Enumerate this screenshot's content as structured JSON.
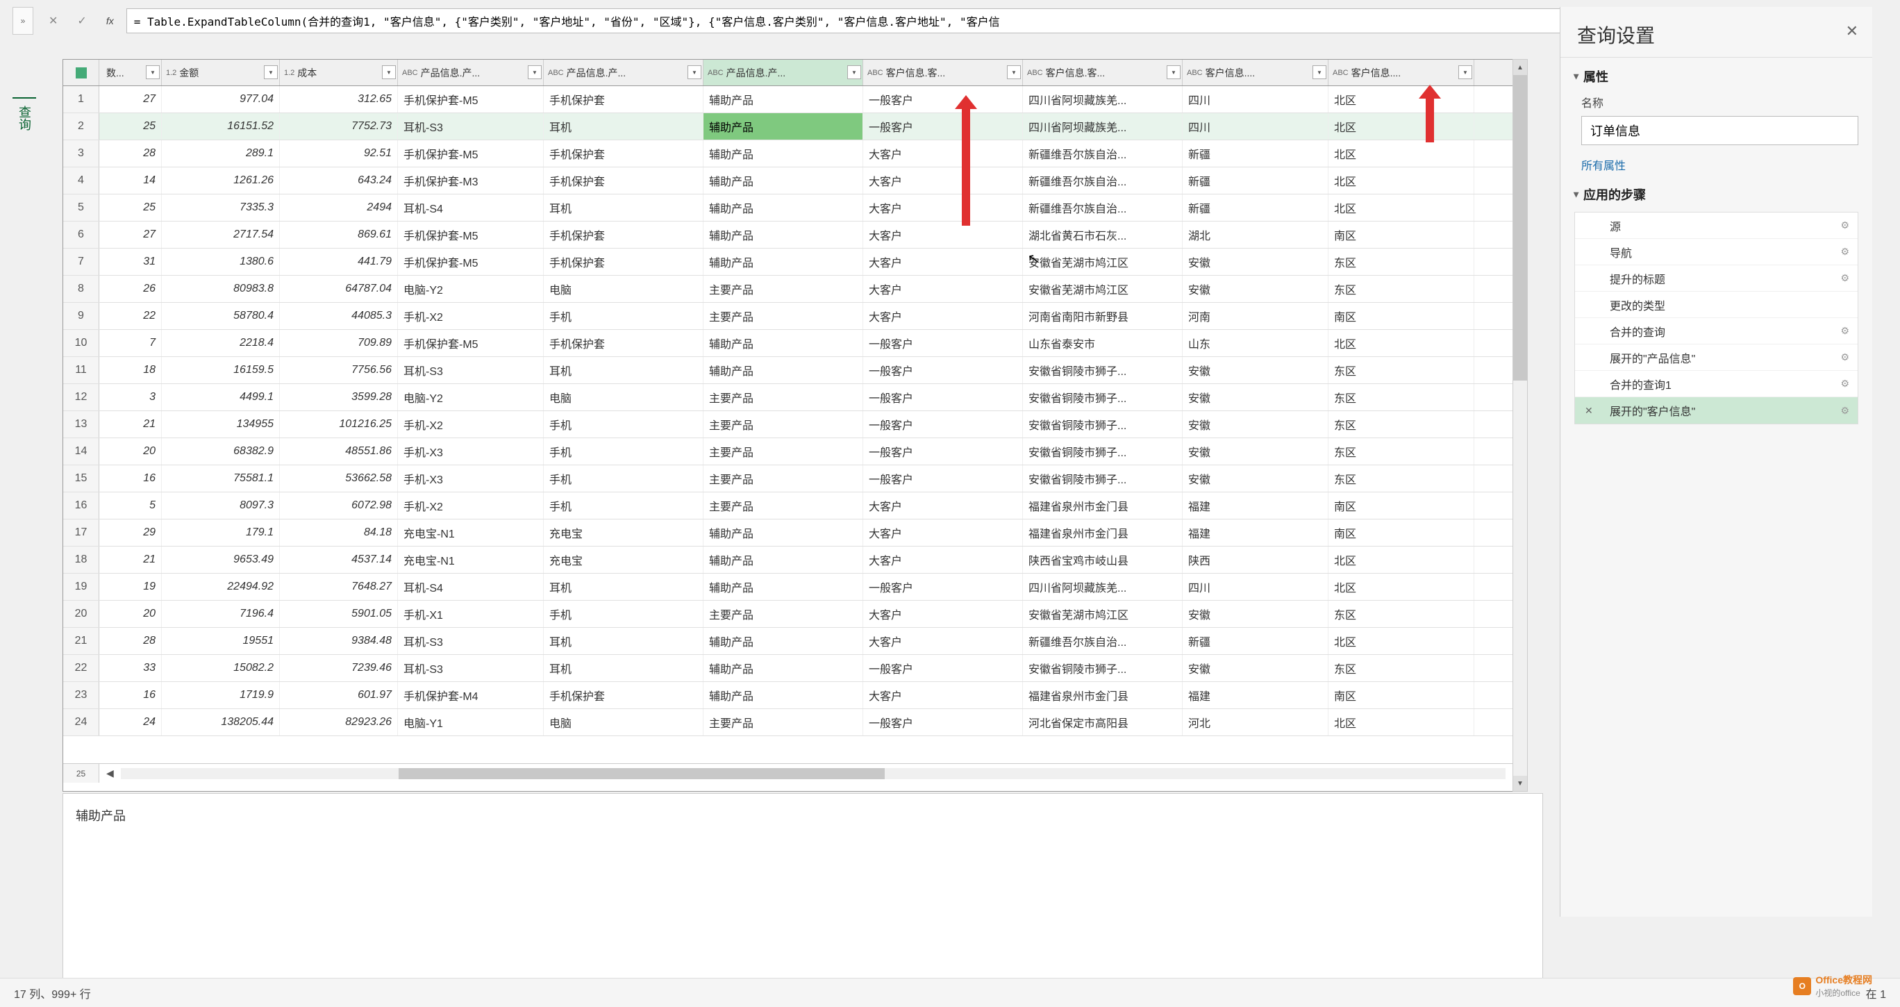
{
  "left_tab_label": "查询",
  "formula_bar": {
    "value": "= Table.ExpandTableColumn(合并的查询1, \"客户信息\", {\"客户类别\", \"客户地址\", \"省份\", \"区域\"}, {\"客户信息.客户类别\", \"客户信息.客户地址\", \"客户信"
  },
  "columns": [
    {
      "type": "",
      "label": "数...",
      "w": "c0"
    },
    {
      "type": "1.2",
      "label": "金额",
      "w": "c1"
    },
    {
      "type": "1.2",
      "label": "成本",
      "w": "c2"
    },
    {
      "type": "ABC",
      "label": "产品信息.产...",
      "w": "c3"
    },
    {
      "type": "ABC",
      "label": "产品信息.产...",
      "w": "c4"
    },
    {
      "type": "ABC",
      "label": "产品信息.产...",
      "w": "c5",
      "active": true
    },
    {
      "type": "ABC",
      "label": "客户信息.客...",
      "w": "c6"
    },
    {
      "type": "ABC",
      "label": "客户信息.客...",
      "w": "c7"
    },
    {
      "type": "ABC",
      "label": "客户信息....",
      "w": "c8"
    },
    {
      "type": "ABC",
      "label": "客户信息....",
      "w": "c9"
    }
  ],
  "rows": [
    {
      "n": 1,
      "d": [
        "27",
        "977.04",
        "312.65",
        "手机保护套-M5",
        "手机保护套",
        "辅助产品",
        "一般客户",
        "四川省阿坝藏族羌...",
        "四川",
        "北区"
      ]
    },
    {
      "n": 2,
      "d": [
        "25",
        "16151.52",
        "7752.73",
        "耳机-S3",
        "耳机",
        "辅助产品",
        "一般客户",
        "四川省阿坝藏族羌...",
        "四川",
        "北区"
      ],
      "sel": true,
      "selcol": 5
    },
    {
      "n": 3,
      "d": [
        "28",
        "289.1",
        "92.51",
        "手机保护套-M5",
        "手机保护套",
        "辅助产品",
        "大客户",
        "新疆维吾尔族自治...",
        "新疆",
        "北区"
      ]
    },
    {
      "n": 4,
      "d": [
        "14",
        "1261.26",
        "643.24",
        "手机保护套-M3",
        "手机保护套",
        "辅助产品",
        "大客户",
        "新疆维吾尔族自治...",
        "新疆",
        "北区"
      ]
    },
    {
      "n": 5,
      "d": [
        "25",
        "7335.3",
        "2494",
        "耳机-S4",
        "耳机",
        "辅助产品",
        "大客户",
        "新疆维吾尔族自治...",
        "新疆",
        "北区"
      ]
    },
    {
      "n": 6,
      "d": [
        "27",
        "2717.54",
        "869.61",
        "手机保护套-M5",
        "手机保护套",
        "辅助产品",
        "大客户",
        "湖北省黄石市石灰...",
        "湖北",
        "南区"
      ]
    },
    {
      "n": 7,
      "d": [
        "31",
        "1380.6",
        "441.79",
        "手机保护套-M5",
        "手机保护套",
        "辅助产品",
        "大客户",
        "安徽省芜湖市鸠江区",
        "安徽",
        "东区"
      ]
    },
    {
      "n": 8,
      "d": [
        "26",
        "80983.8",
        "64787.04",
        "电脑-Y2",
        "电脑",
        "主要产品",
        "大客户",
        "安徽省芜湖市鸠江区",
        "安徽",
        "东区"
      ]
    },
    {
      "n": 9,
      "d": [
        "22",
        "58780.4",
        "44085.3",
        "手机-X2",
        "手机",
        "主要产品",
        "大客户",
        "河南省南阳市新野县",
        "河南",
        "南区"
      ]
    },
    {
      "n": 10,
      "d": [
        "7",
        "2218.4",
        "709.89",
        "手机保护套-M5",
        "手机保护套",
        "辅助产品",
        "一般客户",
        "山东省泰安市",
        "山东",
        "北区"
      ]
    },
    {
      "n": 11,
      "d": [
        "18",
        "16159.5",
        "7756.56",
        "耳机-S3",
        "耳机",
        "辅助产品",
        "一般客户",
        "安徽省铜陵市狮子...",
        "安徽",
        "东区"
      ]
    },
    {
      "n": 12,
      "d": [
        "3",
        "4499.1",
        "3599.28",
        "电脑-Y2",
        "电脑",
        "主要产品",
        "一般客户",
        "安徽省铜陵市狮子...",
        "安徽",
        "东区"
      ]
    },
    {
      "n": 13,
      "d": [
        "21",
        "134955",
        "101216.25",
        "手机-X2",
        "手机",
        "主要产品",
        "一般客户",
        "安徽省铜陵市狮子...",
        "安徽",
        "东区"
      ]
    },
    {
      "n": 14,
      "d": [
        "20",
        "68382.9",
        "48551.86",
        "手机-X3",
        "手机",
        "主要产品",
        "一般客户",
        "安徽省铜陵市狮子...",
        "安徽",
        "东区"
      ]
    },
    {
      "n": 15,
      "d": [
        "16",
        "75581.1",
        "53662.58",
        "手机-X3",
        "手机",
        "主要产品",
        "一般客户",
        "安徽省铜陵市狮子...",
        "安徽",
        "东区"
      ]
    },
    {
      "n": 16,
      "d": [
        "5",
        "8097.3",
        "6072.98",
        "手机-X2",
        "手机",
        "主要产品",
        "大客户",
        "福建省泉州市金门县",
        "福建",
        "南区"
      ]
    },
    {
      "n": 17,
      "d": [
        "29",
        "179.1",
        "84.18",
        "充电宝-N1",
        "充电宝",
        "辅助产品",
        "大客户",
        "福建省泉州市金门县",
        "福建",
        "南区"
      ]
    },
    {
      "n": 18,
      "d": [
        "21",
        "9653.49",
        "4537.14",
        "充电宝-N1",
        "充电宝",
        "辅助产品",
        "大客户",
        "陕西省宝鸡市岐山县",
        "陕西",
        "北区"
      ]
    },
    {
      "n": 19,
      "d": [
        "19",
        "22494.92",
        "7648.27",
        "耳机-S4",
        "耳机",
        "辅助产品",
        "一般客户",
        "四川省阿坝藏族羌...",
        "四川",
        "北区"
      ]
    },
    {
      "n": 20,
      "d": [
        "20",
        "7196.4",
        "5901.05",
        "手机-X1",
        "手机",
        "主要产品",
        "大客户",
        "安徽省芜湖市鸠江区",
        "安徽",
        "东区"
      ]
    },
    {
      "n": 21,
      "d": [
        "28",
        "19551",
        "9384.48",
        "耳机-S3",
        "耳机",
        "辅助产品",
        "大客户",
        "新疆维吾尔族自治...",
        "新疆",
        "北区"
      ]
    },
    {
      "n": 22,
      "d": [
        "33",
        "15082.2",
        "7239.46",
        "耳机-S3",
        "耳机",
        "辅助产品",
        "一般客户",
        "安徽省铜陵市狮子...",
        "安徽",
        "东区"
      ]
    },
    {
      "n": 23,
      "d": [
        "16",
        "1719.9",
        "601.97",
        "手机保护套-M4",
        "手机保护套",
        "辅助产品",
        "大客户",
        "福建省泉州市金门县",
        "福建",
        "南区"
      ]
    },
    {
      "n": 24,
      "d": [
        "24",
        "138205.44",
        "82923.26",
        "电脑-Y1",
        "电脑",
        "主要产品",
        "一般客户",
        "河北省保定市高阳县",
        "河北",
        "北区"
      ]
    }
  ],
  "last_row_num": "25",
  "preview_value": "辅助产品",
  "right_panel": {
    "title": "查询设置",
    "prop_section": "属性",
    "name_label": "名称",
    "name_value": "订单信息",
    "all_props_link": "所有属性",
    "steps_section": "应用的步骤",
    "steps": [
      {
        "label": "源",
        "gear": true
      },
      {
        "label": "导航",
        "gear": true
      },
      {
        "label": "提升的标题",
        "gear": true
      },
      {
        "label": "更改的类型",
        "gear": false
      },
      {
        "label": "合并的查询",
        "gear": true
      },
      {
        "label": "展开的\"产品信息\"",
        "gear": true
      },
      {
        "label": "合并的查询1",
        "gear": true
      },
      {
        "label": "展开的\"客户信息\"",
        "gear": true,
        "active": true
      }
    ]
  },
  "status": {
    "left": "17 列、999+ 行",
    "right": "在 1"
  },
  "watermark": {
    "brand": "Office教程网",
    "sub": "小视的office"
  }
}
